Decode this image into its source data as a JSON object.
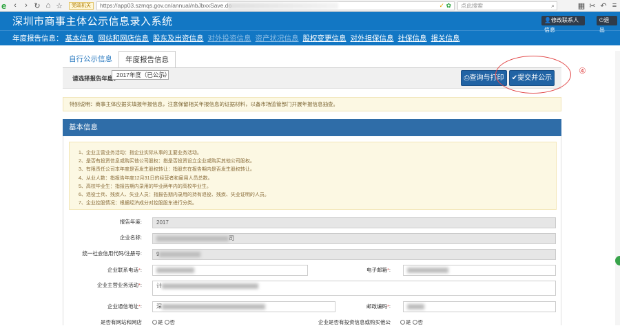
{
  "browser": {
    "secure_badge": "党政机关",
    "url": "https://app03.szmqs.gov.cn/annual/nbJbxxSave.do",
    "search_placeholder": "点此搜索"
  },
  "header": {
    "title": "深圳市商事主体公示信息录入系统",
    "contact_button": "修改联系人信息",
    "logout_button": "退出"
  },
  "nav": {
    "label": "年度报告信息：",
    "items": [
      {
        "label": "基本信息",
        "dim": false
      },
      {
        "label": "网站和网店信息",
        "dim": false
      },
      {
        "label": "股东及出资信息",
        "dim": false
      },
      {
        "label": "对外投资信息",
        "dim": true
      },
      {
        "label": "资产状况信息",
        "dim": true
      },
      {
        "label": "股权变更信息",
        "dim": false
      },
      {
        "label": "对外担保信息",
        "dim": false
      },
      {
        "label": "社保信息",
        "dim": false
      },
      {
        "label": "报关信息",
        "dim": false
      }
    ]
  },
  "tabs": {
    "self_info": "自行公示信息",
    "annual_report": "年度报告信息"
  },
  "toolbar": {
    "year_label": "请选择报告年度：",
    "year_value": "2017年度（已公示）",
    "print_button": "查询与打印",
    "submit_button": "提交并公示"
  },
  "annotation": {
    "marker": "④"
  },
  "notice": "特别说明：商事主体应据实填报年报信息，注意保留相关年报信息的证据材料，以备市场监管部门开展年报信息抽查。",
  "panel": {
    "title": "基本信息",
    "notes": [
      "1、企业主营业务活动：指企业实际从事的主要业务活动。",
      "2、是否有投资信息或购买他公司股权：指是否投资设立企业或购买其他公司股权。",
      "3、有限责任公司本年度是否发生股权转让：指股东在报告期内是否发生股权转让。",
      "4、从业人数：指报告年度12月31日的经营者和雇用人员总数。",
      "5、高校毕业生：指报告期内录用的毕业两年内的高校毕业生。",
      "6、退役士兵、残疾人、失业人员：指报告期内录用的持有退役、残疾、失业证明的人员。",
      "7、企业控股情况：根据经济成分对控股股东进行分类。"
    ],
    "fields": {
      "report_year_label": "报告年度:",
      "report_year_value": "2017",
      "company_name_label": "企业名称:",
      "company_name_value": "司",
      "credit_code_label": "统一社会信用代码/注册号:",
      "credit_code_value": "9",
      "phone_label": "企业联系电话",
      "email_label": "电子邮箱",
      "business_label": "企业主营业务活动",
      "business_value": "计",
      "address_label": "企业通信地址",
      "address_value": "深",
      "postcode_label": "邮政编码",
      "website_label": "是否有网站和网店",
      "investment_label": "企业是否有投资信息或购买他公",
      "yes": "是",
      "no": "否"
    }
  }
}
